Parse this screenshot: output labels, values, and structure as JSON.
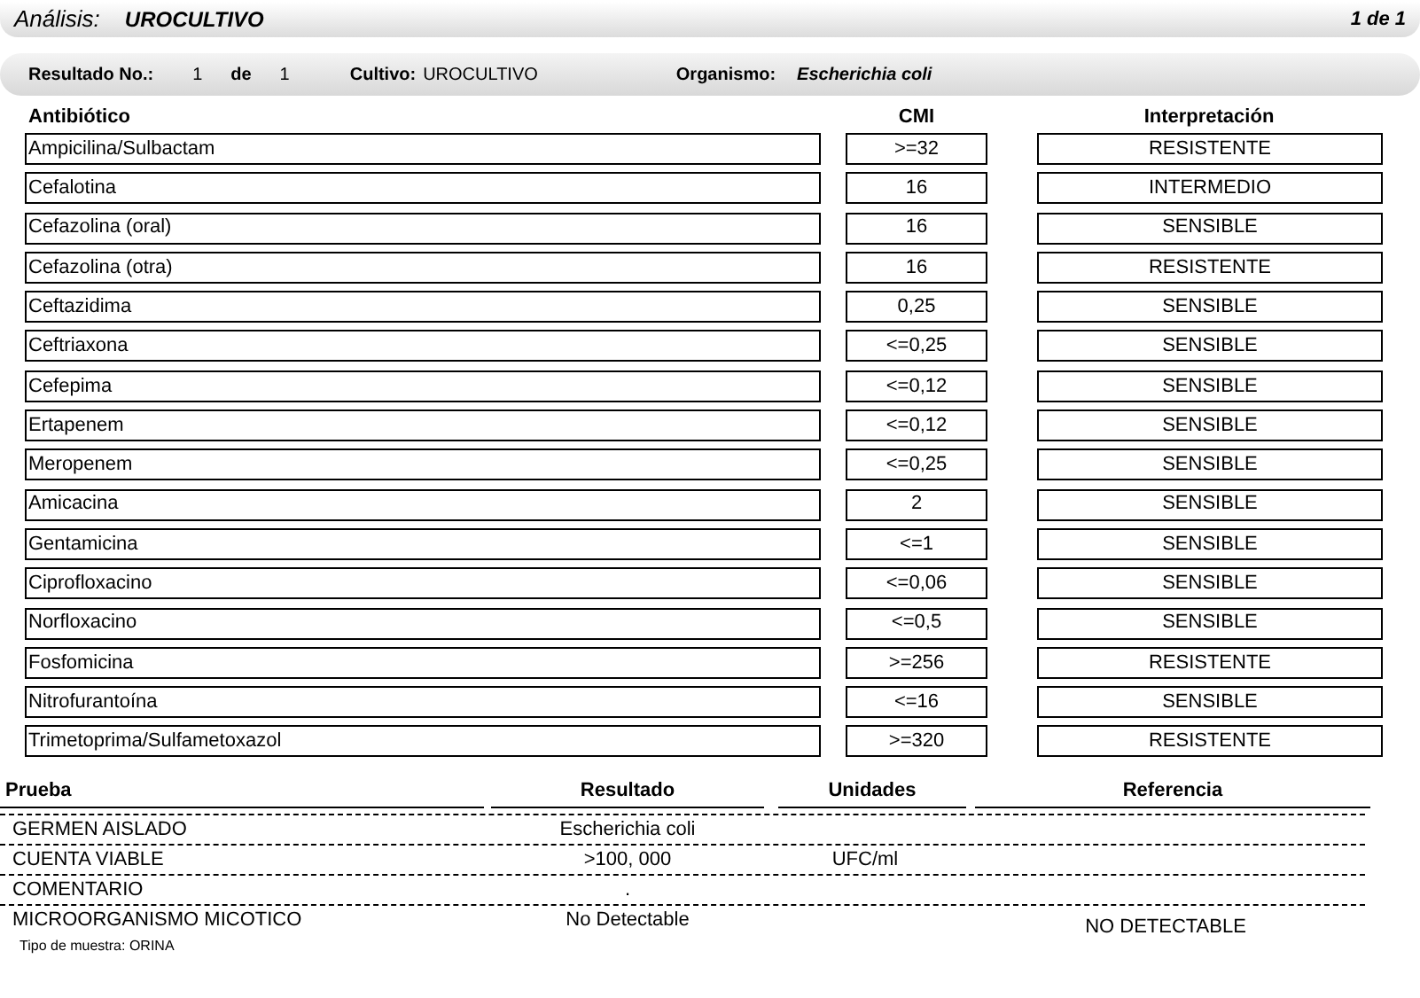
{
  "header": {
    "label": "Análisis:",
    "value": "UROCULTIVO",
    "page": "1 de 1"
  },
  "result_bar": {
    "result_label": "Resultado No.:",
    "result_no": "1",
    "of_label": "de",
    "of_total": "1",
    "culture_label": "Cultivo:",
    "culture": "UROCULTIVO",
    "organism_label": "Organismo:",
    "organism": "Escherichia coli"
  },
  "antibiogram": {
    "columns": [
      "Antibiótico",
      "CMI",
      "Interpretación"
    ],
    "rows": [
      {
        "antibiotic": "Ampicilina/Sulbactam",
        "mic": ">=32",
        "interpretation": "RESISTENTE"
      },
      {
        "antibiotic": "Cefalotina",
        "mic": "16",
        "interpretation": "INTERMEDIO"
      },
      {
        "antibiotic": "Cefazolina (oral)",
        "mic": "16",
        "interpretation": "SENSIBLE"
      },
      {
        "antibiotic": "Cefazolina (otra)",
        "mic": "16",
        "interpretation": "RESISTENTE"
      },
      {
        "antibiotic": "Ceftazidima",
        "mic": "0,25",
        "interpretation": "SENSIBLE"
      },
      {
        "antibiotic": "Ceftriaxona",
        "mic": "<=0,25",
        "interpretation": "SENSIBLE"
      },
      {
        "antibiotic": "Cefepima",
        "mic": "<=0,12",
        "interpretation": "SENSIBLE"
      },
      {
        "antibiotic": "Ertapenem",
        "mic": "<=0,12",
        "interpretation": "SENSIBLE"
      },
      {
        "antibiotic": "Meropenem",
        "mic": "<=0,25",
        "interpretation": "SENSIBLE"
      },
      {
        "antibiotic": "Amicacina",
        "mic": "2",
        "interpretation": "SENSIBLE"
      },
      {
        "antibiotic": "Gentamicina",
        "mic": "<=1",
        "interpretation": "SENSIBLE"
      },
      {
        "antibiotic": "Ciprofloxacino",
        "mic": "<=0,06",
        "interpretation": "SENSIBLE"
      },
      {
        "antibiotic": "Norfloxacino",
        "mic": "<=0,5",
        "interpretation": "SENSIBLE"
      },
      {
        "antibiotic": "Fosfomicina",
        "mic": ">=256",
        "interpretation": "RESISTENTE"
      },
      {
        "antibiotic": "Nitrofurantoína",
        "mic": "<=16",
        "interpretation": "SENSIBLE"
      },
      {
        "antibiotic": "Trimetoprima/Sulfametoxazol",
        "mic": ">=320",
        "interpretation": "RESISTENTE"
      }
    ]
  },
  "tests": {
    "columns": [
      "Prueba",
      "Resultado",
      "Unidades",
      "Referencia"
    ],
    "rows": [
      {
        "test": "GERMEN AISLADO",
        "result": "Escherichia coli"
      },
      {
        "test": "CUENTA VIABLE",
        "result": ">100, 000",
        "units": "UFC/ml"
      },
      {
        "test": "COMENTARIO",
        "result": "."
      },
      {
        "test": "MICROORGANISMO MICOTICO",
        "result": "No Detectable",
        "reference": "NO DETECTABLE"
      }
    ]
  },
  "sample_type": "Tipo de muestra: ORINA"
}
